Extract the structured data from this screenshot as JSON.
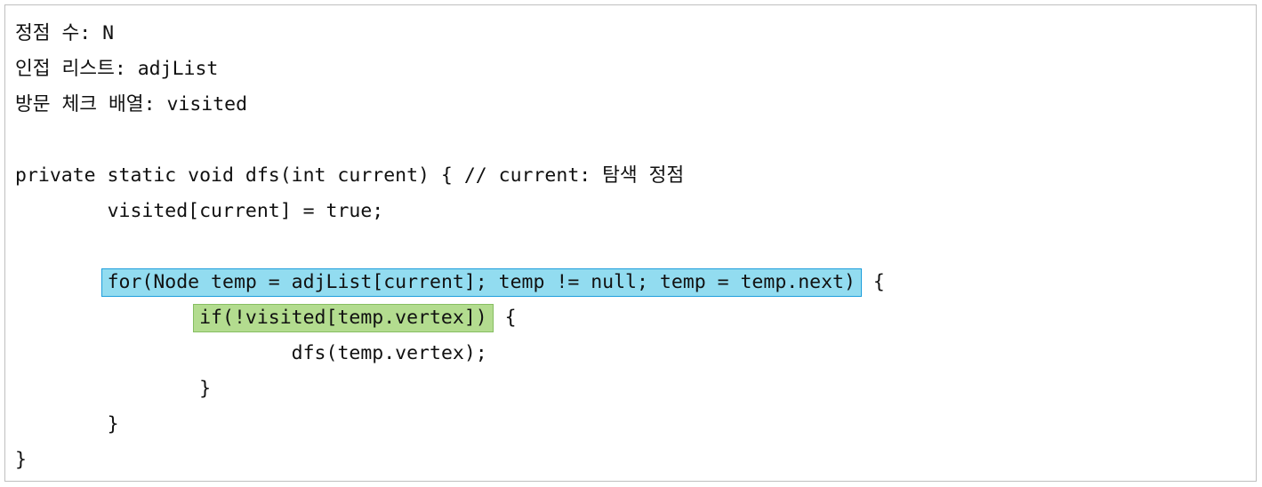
{
  "lines": {
    "l1": "정점 수: N",
    "l2": "인접 리스트: adjList",
    "l3": "방문 체크 배열: visited",
    "l5": "private static void dfs(int current) { // current: 탐색 정점",
    "l6_indent": "        ",
    "l6": "visited[current] = true;",
    "l8_indent": "        ",
    "l8_highlight": "for(Node temp = adjList[current]; temp != null; temp = temp.next)",
    "l8_tail": " {",
    "l9_indent": "                ",
    "l9_highlight": "if(!visited[temp.vertex])",
    "l9_tail": " {",
    "l10_indent": "                        ",
    "l10": "dfs(temp.vertex);",
    "l11_indent": "                ",
    "l11": "}",
    "l12_indent": "        ",
    "l12": "}",
    "l13": "}"
  },
  "colors": {
    "highlight_blue_fill": "#92dcf0",
    "highlight_blue_border": "#1f9fdc",
    "highlight_green_fill": "#b3dc8f",
    "highlight_green_border": "#86be62"
  }
}
